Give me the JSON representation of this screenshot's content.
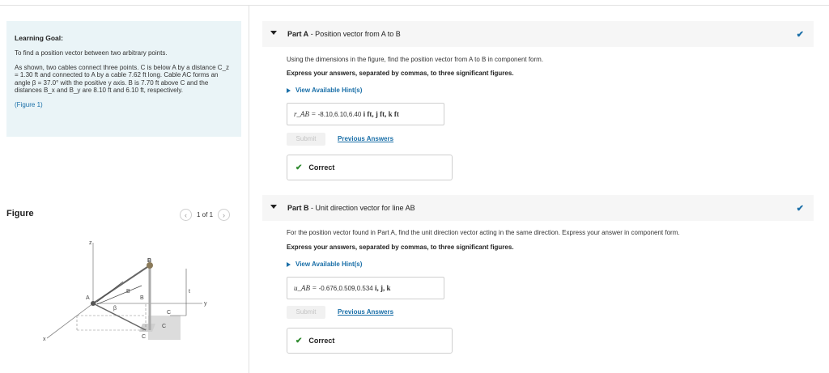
{
  "learning_goal": {
    "title": "Learning Goal:",
    "text1": "To find a position vector between two arbitrary points.",
    "text2": "As shown, two cables connect three points. C is below A by a distance C_z = 1.30 ft and connected to A by a cable 7.62 ft long. Cable AC forms an angle β = 37.0° with the positive y axis. B is 7.70 ft above C and the distances B_x and B_y are 8.10 ft and 6.10 ft, respectively.",
    "figure_link": "(Figure 1)"
  },
  "figure": {
    "title": "Figure",
    "pager": "1 of 1",
    "labels": {
      "z": "z",
      "x": "x",
      "y": "y",
      "A": "A",
      "B": "B",
      "C": "C",
      "beta": "β",
      "By": "B",
      "Bx": "B",
      "Cz": "C",
      "Cz2": "C",
      "t": "t"
    }
  },
  "partA": {
    "title_bold": "Part A",
    "title_rest": " - Position vector from A to B",
    "instruction": "Using the dimensions in the figure, find the position vector from A to B in component form.",
    "instruction_bold": "Express your answers, separated by commas, to three significant figures.",
    "hint": "View Available Hint(s)",
    "answer_label": "r_AB =",
    "answer_value": "-8.10,6.10,6.40",
    "answer_units": "i ft, j ft, k ft",
    "submit": "Submit",
    "previous": "Previous Answers",
    "correct": "Correct"
  },
  "partB": {
    "title_bold": "Part B",
    "title_rest": " - Unit direction vector for line AB",
    "instruction": "For the position vector found in Part A, find the unit direction vector acting in the same direction. Express your answer in component form.",
    "instruction_bold": "Express your answers, separated by commas, to three significant figures.",
    "hint": "View Available Hint(s)",
    "answer_label": "u_AB =",
    "answer_value": "-0.676,0.509,0.534",
    "answer_units": "i, j, k",
    "submit": "Submit",
    "previous": "Previous Answers",
    "correct": "Correct"
  },
  "colors": {
    "accent": "#1a6fa8",
    "goal_bg": "#eaf4f7",
    "correct_green": "#2e8a2e"
  }
}
